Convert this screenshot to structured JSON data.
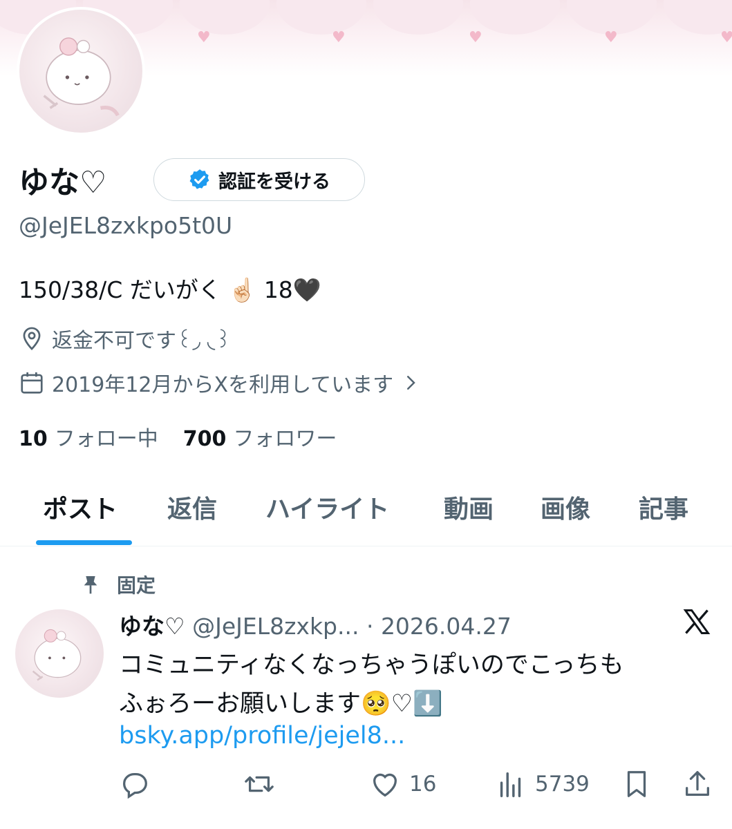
{
  "profile": {
    "display_name": "ゆな♡",
    "verify_button_label": "認証を受ける",
    "handle": "@JeJEL8zxkpo5t0U",
    "bio": "150/38/C だいがく ☝🏻 18🖤",
    "location": "返金不可です꒰◞ ◟꒱",
    "joined": "2019年12月からXを利用しています",
    "following_count": "10",
    "following_label": "フォロー中",
    "followers_count": "700",
    "followers_label": "フォロワー"
  },
  "tabs": [
    {
      "label": "ポスト"
    },
    {
      "label": "返信"
    },
    {
      "label": "ハイライト"
    },
    {
      "label": "動画"
    },
    {
      "label": "画像"
    },
    {
      "label": "記事"
    }
  ],
  "pinned_post": {
    "pinned_label": "固定",
    "author_name": "ゆな♡",
    "author_handle_date": "@JeJEL8zxkp... · 2026.04.27",
    "text_line1": "コミュニティなくなっちゃうぽいのでこっちも",
    "text_line2": "ふぉろーお願いします🥺♡⬇️",
    "link": "bsky.app/profile/jejel8...",
    "likes": "16",
    "views": "5739"
  },
  "colors": {
    "accent": "#1d9bf0",
    "secondary_text": "#536471",
    "primary_text": "#0f1419"
  },
  "icons": [
    "verified-badge-icon",
    "location-pin-icon",
    "calendar-icon",
    "chevron-right-icon",
    "pin-icon",
    "x-logo-icon",
    "reply-icon",
    "repost-icon",
    "like-icon",
    "views-icon",
    "bookmark-icon",
    "share-icon"
  ]
}
